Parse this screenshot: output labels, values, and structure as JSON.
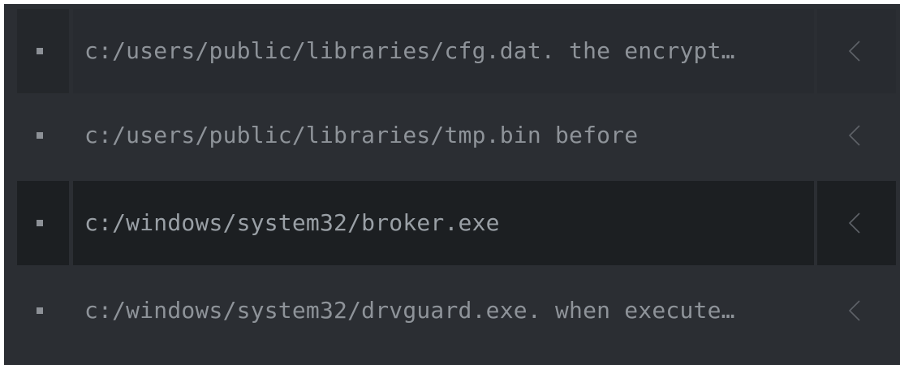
{
  "list": {
    "items": [
      {
        "text": "c:/users/public/libraries/cfg.dat. the encrypt…",
        "chevron_icon": "chevron-left-icon",
        "state": "alt"
      },
      {
        "text": "c:/users/public/libraries/tmp.bin before",
        "chevron_icon": "chevron-left-icon",
        "state": "default"
      },
      {
        "text": "c:/windows/system32/broker.exe",
        "chevron_icon": "chevron-left-icon",
        "state": "selected"
      },
      {
        "text": "c:/windows/system32/drvguard.exe. when execute…",
        "chevron_icon": "chevron-left-icon",
        "state": "default"
      }
    ]
  },
  "colors": {
    "panel_bg": "#2b2e33",
    "alt_row_bg": "#282b30",
    "selected_row_bg": "#1c1f22",
    "text": "#8e9399",
    "bullet": "#8d9197",
    "chevron": "#5e6268"
  }
}
